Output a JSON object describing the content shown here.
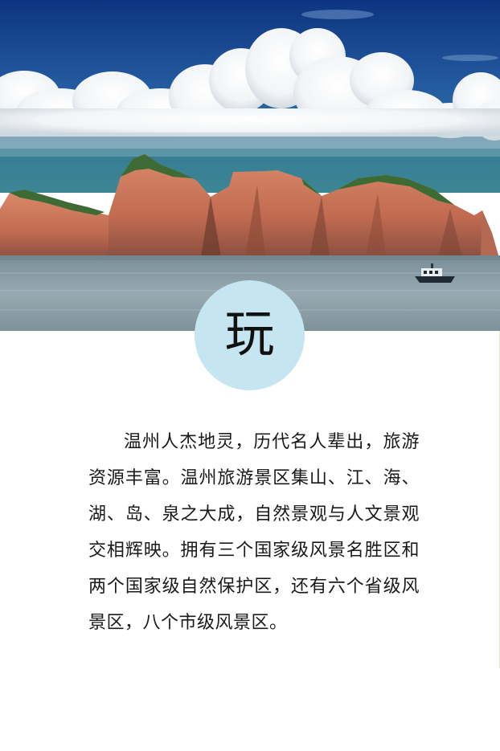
{
  "hero": {
    "badge_char": "玩",
    "colors": {
      "sky_top": "#0f3a88",
      "sky_mid": "#2a63a6",
      "horizon": "#3c8596",
      "sea": "#8a9da6",
      "rock": "#c8785e",
      "vegetation": "#3e6a34",
      "badge_bg": "#c5e5f0"
    }
  },
  "content": {
    "paragraph": "温州人杰地灵，历代名人辈出，旅游资源丰富。温州旅游景区集山、江、海、湖、岛、泉之大成，自然景观与人文景观交相辉映。拥有三个国家级风景名胜区和两个国家级自然保护区，还有六个省级风景区，八个市级风景区。"
  }
}
